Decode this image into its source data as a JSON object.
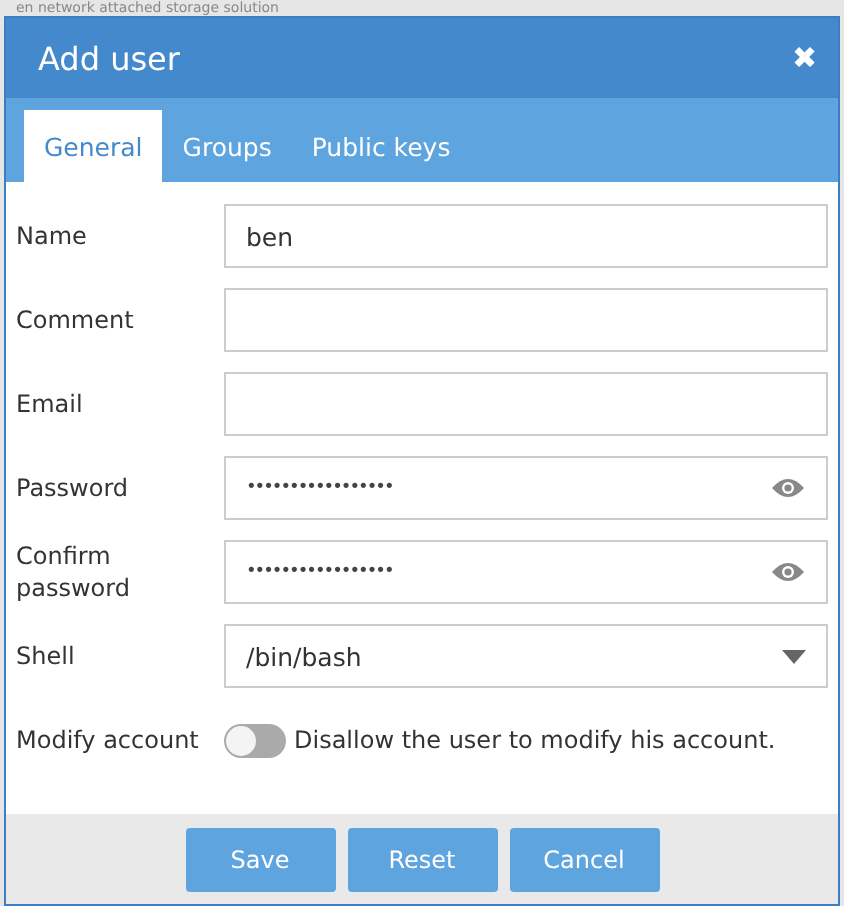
{
  "background_text": "en network attached storage solution",
  "dialog": {
    "title": "Add user",
    "close": "✖"
  },
  "tabs": [
    {
      "label": "General",
      "selected": true
    },
    {
      "label": "Groups",
      "selected": false
    },
    {
      "label": "Public keys",
      "selected": false
    }
  ],
  "fields": [
    {
      "kind": "text",
      "label": "Name",
      "value": "ben"
    },
    {
      "kind": "text",
      "label": "Comment"
    },
    {
      "kind": "text",
      "label": "Email"
    },
    {
      "kind": "password",
      "label": "Password",
      "value": "•••••••••••••••••"
    },
    {
      "kind": "password",
      "label": "Confirm password",
      "value": "•••••••••••••••••"
    },
    {
      "kind": "select",
      "label": "Shell",
      "value": "/bin/bash"
    },
    {
      "kind": "toggle",
      "label": "Modify account",
      "on": false,
      "text": "Disallow the user to modify his account."
    }
  ],
  "buttons": [
    "Save",
    "Reset",
    "Cancel"
  ]
}
